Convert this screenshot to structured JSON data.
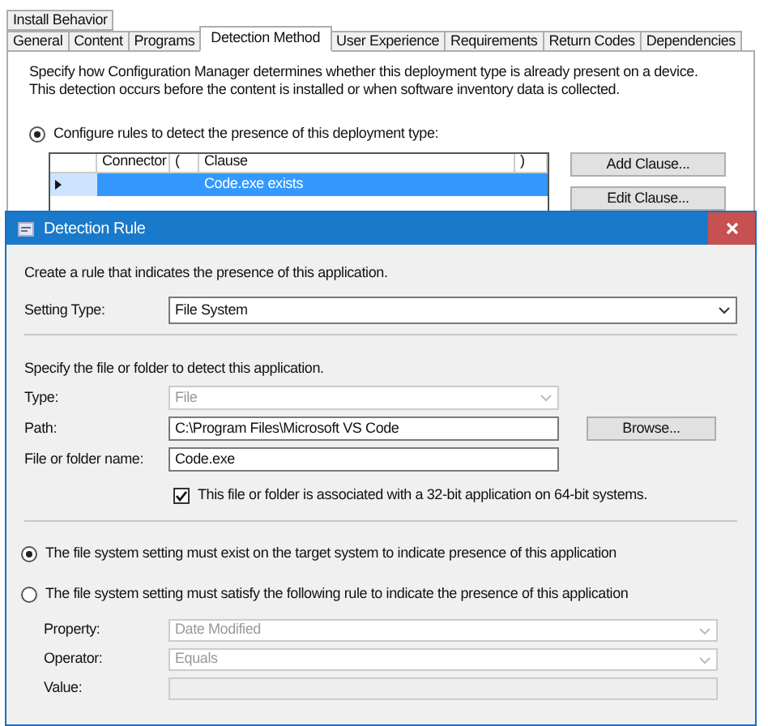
{
  "properties_window": {
    "tab_rows": [
      [
        {
          "label": "Install Behavior",
          "selected": false
        }
      ],
      [
        {
          "label": "General",
          "selected": false
        },
        {
          "label": "Content",
          "selected": false
        },
        {
          "label": "Programs",
          "selected": false
        },
        {
          "label": "Detection Method",
          "selected": true
        },
        {
          "label": "User Experience",
          "selected": false
        },
        {
          "label": "Requirements",
          "selected": false
        },
        {
          "label": "Return Codes",
          "selected": false
        },
        {
          "label": "Dependencies",
          "selected": false
        }
      ]
    ],
    "description": "Specify how Configuration Manager determines whether this deployment type is already present on a device. This detection occurs before the content is installed or when software inventory data is collected.",
    "rules_option": {
      "label": "Configure rules to detect the presence of this deployment type:",
      "selected": true
    },
    "clause_table": {
      "columns": [
        "Connector",
        "(",
        "Clause",
        ")"
      ],
      "rows": [
        {
          "cells": [
            "",
            "",
            "Code.exe exists",
            ""
          ],
          "selected": true
        }
      ]
    },
    "buttons": [
      "Add Clause...",
      "Edit Clause..."
    ]
  },
  "dialog": {
    "title": "Detection Rule",
    "intro": "Create a rule that indicates the presence of this application.",
    "setting_type": {
      "label": "Setting Type:",
      "value": "File System",
      "kind": "combo",
      "disabled": false
    },
    "specify": "Specify the file or folder to detect this application.",
    "fields": [
      {
        "label": "Type:",
        "value": "File",
        "kind": "combo",
        "disabled": true
      },
      {
        "label": "Path:",
        "value": "C:\\Program Files\\Microsoft VS Code",
        "kind": "text",
        "disabled": false
      },
      {
        "label": "File or folder name:",
        "value": "Code.exe",
        "kind": "text",
        "disabled": false
      }
    ],
    "browse_button": "Browse...",
    "checkbox": {
      "label": "This file or folder is associated with a 32-bit application on 64-bit systems.",
      "checked": true
    },
    "options": [
      {
        "label": "The file system setting must exist on the target system to indicate presence of this application",
        "selected": true
      },
      {
        "label": "The file system setting must satisfy the following rule to indicate the presence of this application",
        "selected": false
      }
    ],
    "rule_fields": [
      {
        "label": "Property:",
        "value": "Date Modified",
        "kind": "combo",
        "disabled": true
      },
      {
        "label": "Operator:",
        "value": "Equals",
        "kind": "combo",
        "disabled": true
      },
      {
        "label": "Value:",
        "kind": "text",
        "disabled": true
      }
    ]
  }
}
